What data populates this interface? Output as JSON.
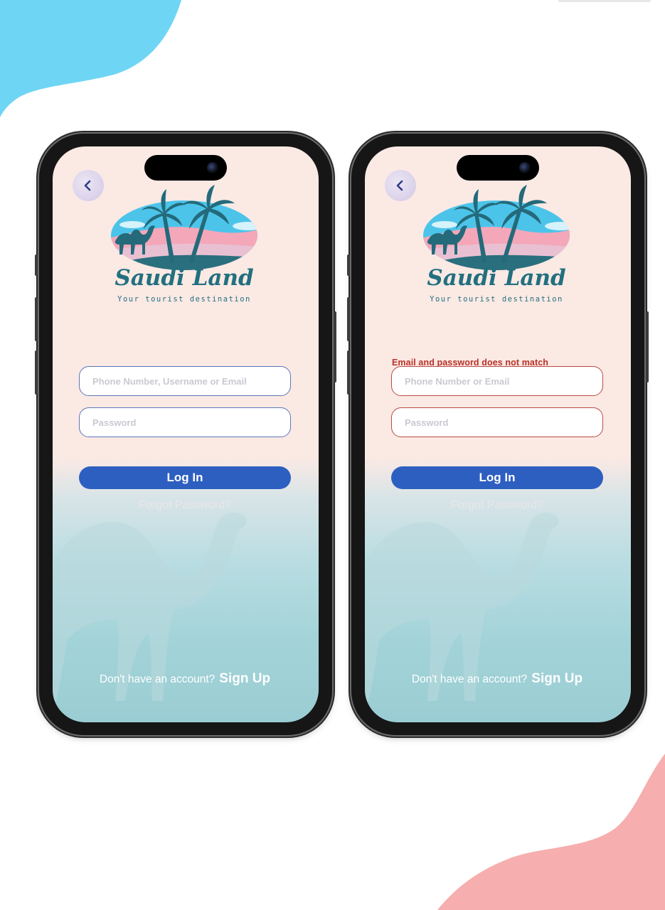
{
  "colors": {
    "accent_blue": "#2d5fc1",
    "error_red": "#b7322a",
    "blob_blue": "#6fd5f4",
    "blob_pink": "#f7aeae",
    "screen_top": "#fbe9e4",
    "screen_bottom": "#9acdd3"
  },
  "icons": {
    "back": "chevron-left-icon",
    "logo": "saudi-land-logo",
    "camel": "camel-silhouette"
  },
  "logo": {
    "title": "Saudi Land",
    "tagline": "Your tourist destination"
  },
  "screens": [
    {
      "state": "default",
      "error": "",
      "identifier_placeholder": "Phone Number, Username or Email",
      "password_placeholder": "Password",
      "login_label": "Log In",
      "forgot_label": "Forgot Password?",
      "signup_prompt": "Don't have an account?",
      "signup_label": "Sign Up"
    },
    {
      "state": "error",
      "error": "Email and password does not match",
      "identifier_placeholder": "Phone Number or Email",
      "password_placeholder": "Password",
      "login_label": "Log In",
      "forgot_label": "Forgot Password?",
      "signup_prompt": "Don't have an account?",
      "signup_label": "Sign Up"
    }
  ]
}
